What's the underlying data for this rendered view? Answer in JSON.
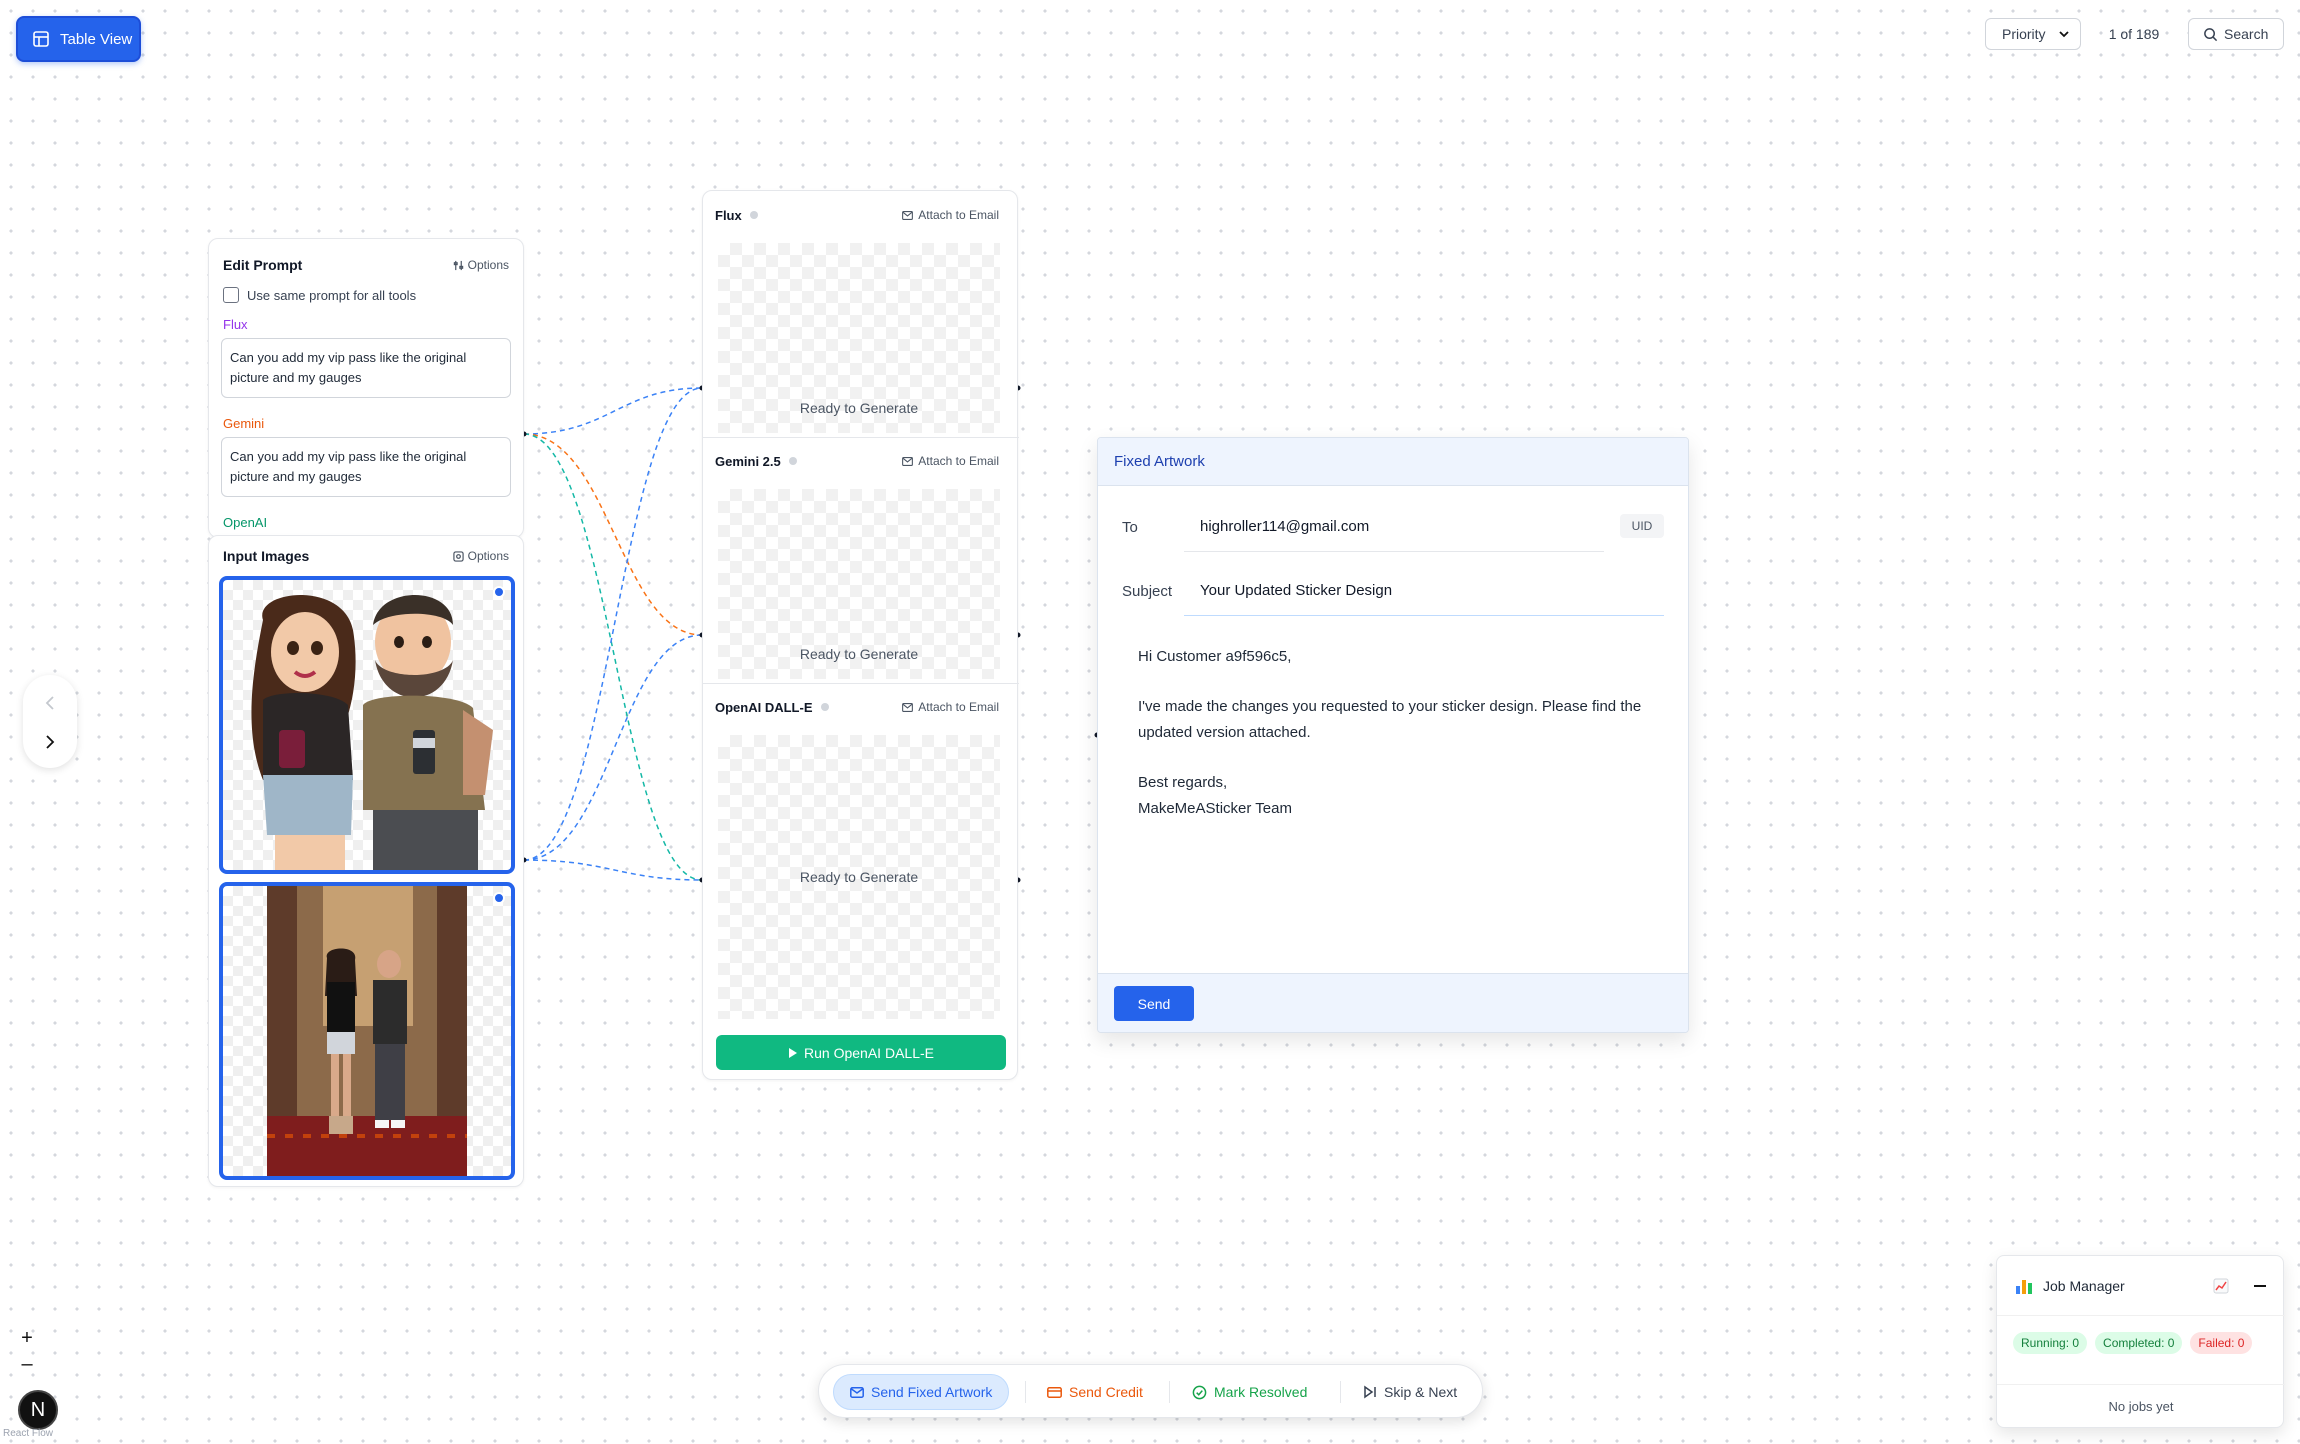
{
  "toolbar": {
    "table_view_label": "Table View",
    "priority_label": "Priority",
    "page_count": "1 of 189",
    "search_label": "Search"
  },
  "edit_prompt": {
    "title": "Edit Prompt",
    "options_label": "Options",
    "same_prompt_label": "Use same prompt for all tools",
    "tools": [
      {
        "name": "Flux",
        "color": "#9333ea",
        "prompt": "Can you add my vip pass like the original picture and my gauges"
      },
      {
        "name": "Gemini",
        "color": "#ea580c",
        "prompt": "Can you add my vip pass like the original picture and my gauges"
      },
      {
        "name": "OpenAI",
        "color": "#059669"
      }
    ]
  },
  "input_images": {
    "title": "Input Images",
    "options_label": "Options"
  },
  "generators": [
    {
      "name": "Flux",
      "attach_label": "Attach to Email",
      "status": "Ready to Generate"
    },
    {
      "name": "Gemini 2.5",
      "attach_label": "Attach to Email",
      "status": "Ready to Generate"
    },
    {
      "name": "OpenAI DALL-E",
      "attach_label": "Attach to Email",
      "status": "Ready to Generate"
    }
  ],
  "run_button_label": "Run OpenAI DALL-E",
  "email": {
    "title": "Fixed Artwork",
    "to_label": "To",
    "to_value": "highroller114@gmail.com",
    "uid_label": "UID",
    "subject_label": "Subject",
    "subject_value": "Your Updated Sticker Design",
    "greeting": "Hi Customer a9f596c5,",
    "body": "I've made the changes you requested to your sticker design. Please find the updated version attached.",
    "signoff_1": "Best regards,",
    "signoff_2": "MakeMeASticker Team",
    "send_label": "Send"
  },
  "actions": {
    "send_fixed": "Send Fixed Artwork",
    "send_credit": "Send Credit",
    "mark_resolved": "Mark Resolved",
    "skip_next": "Skip & Next"
  },
  "job_manager": {
    "title": "Job Manager",
    "running": "Running: 0",
    "completed": "Completed: 0",
    "failed": "Failed: 0",
    "empty": "No jobs yet"
  },
  "flow": {
    "zoom_in": "+",
    "zoom_out": "–",
    "logo_letter": "N",
    "attribution": "React Flow"
  },
  "colors": {
    "accent": "#2563eb",
    "run_green": "#10b981",
    "edge_blue": "#3b82f6",
    "edge_orange": "#f97316",
    "edge_teal": "#14b8a6"
  }
}
